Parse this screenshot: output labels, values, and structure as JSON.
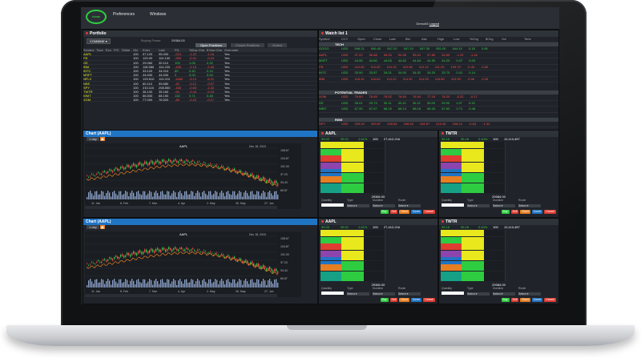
{
  "app": {
    "logo": "TRADE",
    "menu": [
      "Preferences",
      "Windows"
    ],
    "user": "Demo06",
    "logout": "Logout"
  },
  "portfolio": {
    "title": "Portfolio",
    "account": "COMBINE ▾",
    "balance_label": "Buying Power",
    "balance_value": "29384.00",
    "tabs": [
      "Open Positions",
      "Closed Positions",
      "Orders"
    ],
    "columns": [
      "Symbol",
      "Type",
      "Exp",
      "P/C",
      "Strike",
      "Qty",
      "Entry",
      "Last",
      "P/L",
      "%Day Chg",
      "$ Day Chg",
      "Overnight"
    ],
    "rows": [
      {
        "sym": "AAPL",
        "qty": "100",
        "entry": "97.120",
        "last": "95.000",
        "pl": "-212",
        "chg": "-1.22",
        "day": "-1.16",
        "on": "Yes"
      },
      {
        "sym": "FB",
        "qty": "100",
        "entry": "120.00",
        "last": "110.100",
        "pl": "-990",
        "chg": "-0.41",
        "day": "-0.44",
        "on": "Yes"
      },
      {
        "sym": "GE",
        "qty": "100",
        "entry": "29.060",
        "last": "30.110",
        "pl": "105",
        "chg": "1.05",
        "day": "0.32",
        "on": "Yes"
      },
      {
        "sym": "IBM",
        "qty": "100",
        "entry": "118.580",
        "last": "114.220",
        "pl": "-436",
        "chg": "-2.10",
        "day": "-2.40",
        "on": "Yes"
      },
      {
        "sym": "INTC",
        "qty": "100",
        "entry": "33.120",
        "last": "34.010",
        "pl": "89",
        "chg": "0.40",
        "day": "0.14",
        "on": "Yes"
      },
      {
        "sym": "MSFT",
        "qty": "100",
        "entry": "44.630",
        "last": "44.630",
        "pl": "0",
        "chg": "0.00",
        "day": "0.00",
        "on": "Yes"
      },
      {
        "sym": "NFLX",
        "qty": "100",
        "entry": "129.810",
        "last": "113.210",
        "pl": "-1660",
        "chg": "-5.10",
        "day": "-6.21",
        "on": "Yes"
      },
      {
        "sym": "NKE",
        "qty": "100",
        "entry": "60.110",
        "last": "59.680",
        "pl": "-43",
        "chg": "-0.12",
        "day": "-0.07",
        "on": "Yes"
      },
      {
        "sym": "SPY",
        "qty": "100",
        "entry": "210.110",
        "last": "208.550",
        "pl": "-156",
        "chg": "-0.63",
        "day": "-1.32",
        "on": "Yes"
      },
      {
        "sym": "TWTR",
        "qty": "100",
        "entry": "36.100",
        "last": "35.160",
        "pl": "-94",
        "chg": "-0.44",
        "day": "-0.15",
        "on": "Yes"
      },
      {
        "sym": "WMT",
        "qty": "100",
        "entry": "66.830",
        "last": "68.150",
        "pl": "132",
        "chg": "0.71",
        "day": "0.48",
        "on": "Yes"
      },
      {
        "sym": "XOM",
        "qty": "100",
        "entry": "77.000",
        "last": "76.520",
        "pl": "-48",
        "chg": "-0.22",
        "day": "-0.17",
        "on": "Yes"
      }
    ]
  },
  "watchlist": {
    "title": "Watch list 1",
    "columns": [
      "Symbol",
      "CCY",
      "Open",
      "Close",
      "Last",
      "Bid",
      "Ask",
      "High",
      "Low",
      "%Chg",
      "$Chg",
      "Vol",
      "Time"
    ],
    "group1": "TECH",
    "group2": "POTENTIAL TRADES",
    "group3": "RISK",
    "rows1": [
      {
        "sym": "GOOG",
        "v": "USD 546.21 546.40 547.20 547.10 547.30 551.00 544.10 0.18 0.95"
      },
      {
        "sym": "AAPL",
        "v": "USD 97.22 96.88 95.00 94.98 95.01 97.80 94.55 -1.22 -1.16"
      },
      {
        "sym": "MSFT",
        "v": "USD 44.55 44.60 44.63 44.62 44.64 44.90 44.20 0.07 0.03"
      },
      {
        "sym": "FB",
        "v": "USD 110.40 110.60 110.10 110.08 110.12 111.20 109.70 -0.45 -0.50"
      },
      {
        "sym": "INTC",
        "v": "USD 33.90 33.87 34.01 34.00 34.02 34.20 33.70 0.41 0.14"
      },
      {
        "sym": "IBM",
        "v": "USD 116.10 116.62 114.22 114.20 114.25 116.80 113.90 -2.06 -2.40"
      }
    ],
    "rows2": [
      {
        "sym": "XOM",
        "v": "USD 76.60 76.69 76.52 76.50 76.54 77.10 76.20 -0.22 -0.17"
      },
      {
        "sym": "GE",
        "v": "USD 30.01 29.79 30.11 30.10 30.12 30.25 29.90 1.07 0.32"
      },
      {
        "sym": "WMT",
        "v": "USD 67.90 67.67 68.15 68.14 68.16 68.40 67.60 0.71 0.48"
      }
    ],
    "rows3": [
      {
        "sym": "SPY",
        "v": "USD 209.20 209.87 208.55 208.53 208.57 210.30 208.10 -0.63 -1.32"
      }
    ]
  },
  "charts": [
    {
      "title": "Chart (AAPL)",
      "interval": "1 day",
      "symbol": "AAPL",
      "date": "Dec 18, 2015",
      "xticks": [
        "11. Jan",
        "8. Feb",
        "7. Mar",
        "4. Apr",
        "2. May",
        "30. May",
        "27. Jun"
      ],
      "yticks": [
        "108.67",
        "104.87",
        "101.00",
        "97.23",
        "93.43",
        "89.57"
      ],
      "price": "95.00"
    },
    {
      "title": "Chart (AAPL)",
      "interval": "1 day",
      "symbol": "AAPL",
      "date": "Dec 18, 2015",
      "xticks": [
        "11. Jan",
        "8. Feb",
        "7. Mar",
        "4. Apr",
        "2. May",
        "30. May",
        "27. Jun"
      ],
      "yticks": [
        "108.67",
        "104.87",
        "101.00",
        "97.23",
        "93.43",
        "89.57"
      ],
      "price": "95.00"
    }
  ],
  "books": [
    {
      "title": "AAPL",
      "bid": "95.00",
      "ask": "95.01",
      "chg": "1.61%",
      "size": "100",
      "vol": "27,412,216",
      "total": "29384.00",
      "labels": [
        "Quantity",
        "Type",
        "Duration",
        "Route"
      ],
      "select": "Select ▾",
      "buttons": [
        "Buy",
        "Sell",
        "Short",
        "Cover",
        "Cancel"
      ]
    },
    {
      "title": "TWTR",
      "bid": "35.16",
      "ask": "35.18",
      "chg": "0.44%",
      "size": "100",
      "vol": "12,110,457",
      "total": "29384.00",
      "labels": [
        "Quantity",
        "Type",
        "Duration",
        "Route"
      ],
      "select": "Select ▾",
      "buttons": [
        "Buy",
        "Sell",
        "Short",
        "Cover",
        "Cancel"
      ]
    },
    {
      "title": "AAPL",
      "bid": "95.00",
      "ask": "95.01",
      "chg": "1.61%",
      "size": "100",
      "vol": "27,412,216",
      "total": "29384.00",
      "labels": [
        "Quantity",
        "Type",
        "Duration",
        "Route"
      ],
      "select": "Select ▾",
      "buttons": [
        "Buy",
        "Sell",
        "Short",
        "Cover",
        "Cancel"
      ]
    },
    {
      "title": "TWTR",
      "bid": "35.16",
      "ask": "35.18",
      "chg": "0.44%",
      "size": "100",
      "vol": "12,110,457",
      "total": "29384.00",
      "labels": [
        "Quantity",
        "Type",
        "Duration",
        "Route"
      ],
      "select": "Select ▾",
      "buttons": [
        "Buy",
        "Sell",
        "Short",
        "Cover",
        "Cancel"
      ]
    }
  ],
  "colors": {
    "up": "#35d04a",
    "down": "#ff4b4b",
    "accent": "#1f74c4",
    "level_colors": [
      "#e8e81c",
      "#2ecc40",
      "#e03c31",
      "#8e44ad",
      "#1f74c4",
      "#e67e22",
      "#16a085"
    ]
  }
}
